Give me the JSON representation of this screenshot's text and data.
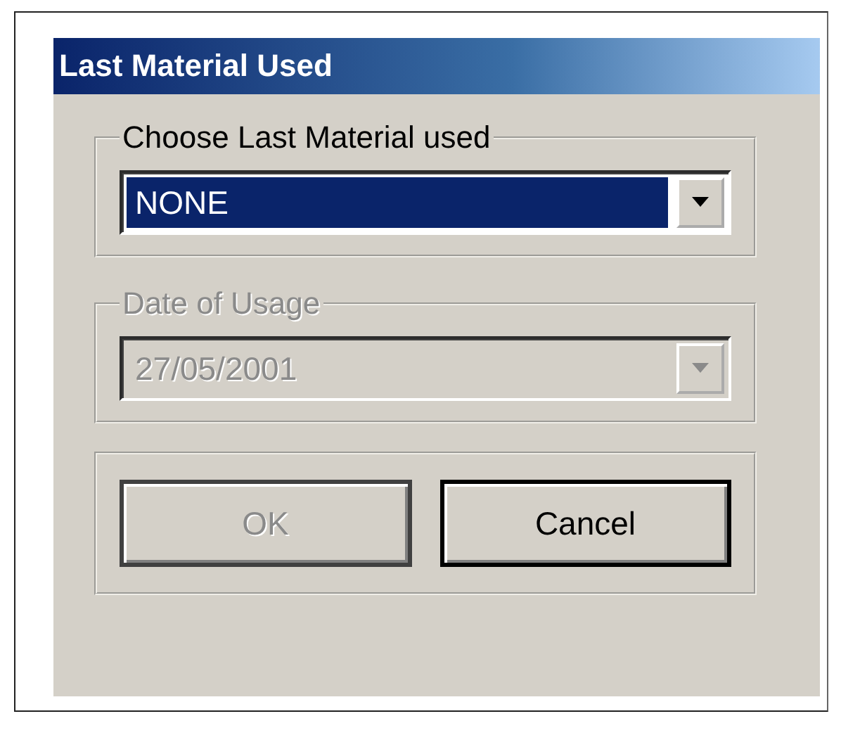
{
  "window": {
    "title": "Last Material Used"
  },
  "groups": [
    {
      "kind": "combo",
      "label": "Choose Last Material used",
      "value": "NONE",
      "disabled": false,
      "selected": true
    },
    {
      "kind": "combo",
      "label": "Date of Usage",
      "value": "27/05/2001",
      "disabled": true,
      "selected": false
    },
    {
      "kind": "buttons",
      "buttons": [
        {
          "label": "OK",
          "disabled": true
        },
        {
          "label": "Cancel",
          "disabled": false
        }
      ]
    }
  ]
}
